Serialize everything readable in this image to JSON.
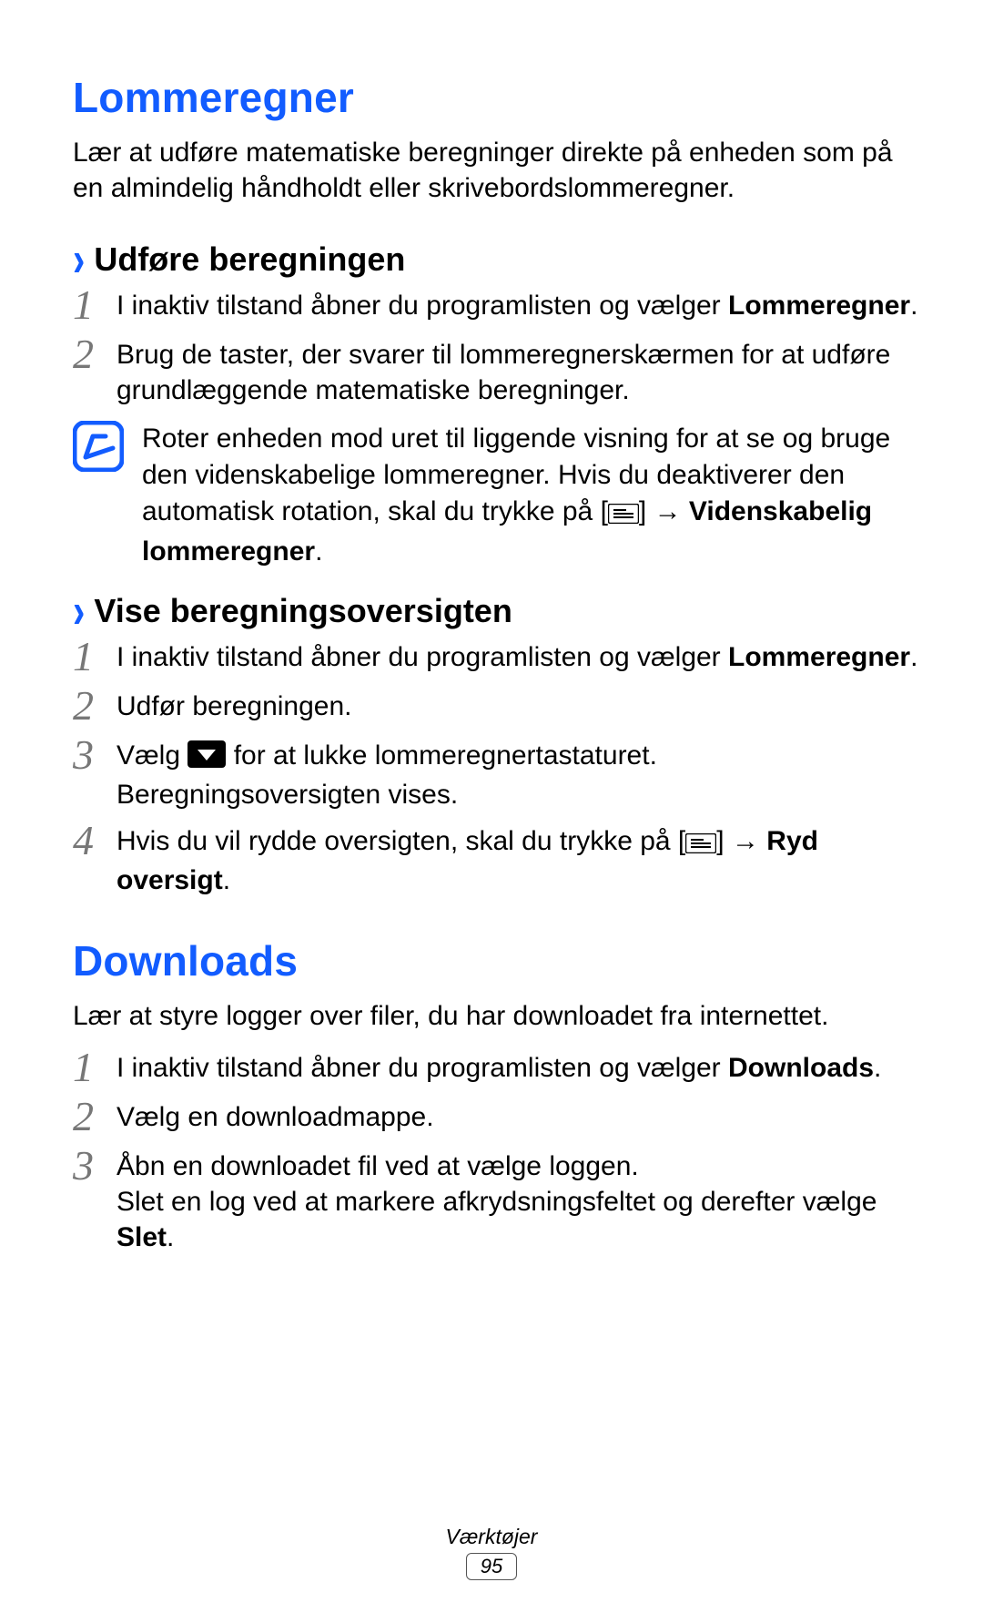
{
  "section1": {
    "title": "Lommeregner",
    "intro": "Lær at udføre matematiske beregninger direkte på enheden som på en almindelig håndholdt eller skrivebordslommeregner.",
    "sub1": {
      "label": "Udføre beregningen",
      "step1_a": "I inaktiv tilstand åbner du programlisten og vælger ",
      "step1_b": "Lommeregner",
      "step1_c": ".",
      "step2": "Brug de taster, der svarer til lommeregnerskærmen for at udføre grundlæggende matematiske beregninger.",
      "note_a": "Roter enheden mod uret til liggende visning for at se og bruge den videnskabelige lommeregner. Hvis du deaktiverer den automatisk rotation, skal du trykke på [",
      "note_b": "] → ",
      "note_c": "Videnskabelig lommeregner",
      "note_d": "."
    },
    "sub2": {
      "label": "Vise beregningsoversigten",
      "step1_a": "I inaktiv tilstand åbner du programlisten og vælger ",
      "step1_b": "Lommeregner",
      "step1_c": ".",
      "step2": "Udfør beregningen.",
      "step3_a": "Vælg ",
      "step3_b": " for at lukke lommeregnertastaturet. Beregningsoversigten vises.",
      "step4_a": "Hvis du vil rydde oversigten, skal du trykke på [",
      "step4_b": "] → ",
      "step4_c": "Ryd oversigt",
      "step4_d": "."
    }
  },
  "section2": {
    "title": "Downloads",
    "intro": "Lær at styre logger over filer, du har downloadet fra internettet.",
    "step1_a": "I inaktiv tilstand åbner du programlisten og vælger ",
    "step1_b": "Downloads",
    "step1_c": ".",
    "step2": "Vælg en downloadmappe.",
    "step3_a": "Åbn en downloadet fil ved at vælge loggen.",
    "step3_b": "Slet en log ved at markere afkrydsningsfeltet og derefter vælge ",
    "step3_c": "Slet",
    "step3_d": "."
  },
  "footer": {
    "chapter": "Værktøjer",
    "page": "95"
  }
}
